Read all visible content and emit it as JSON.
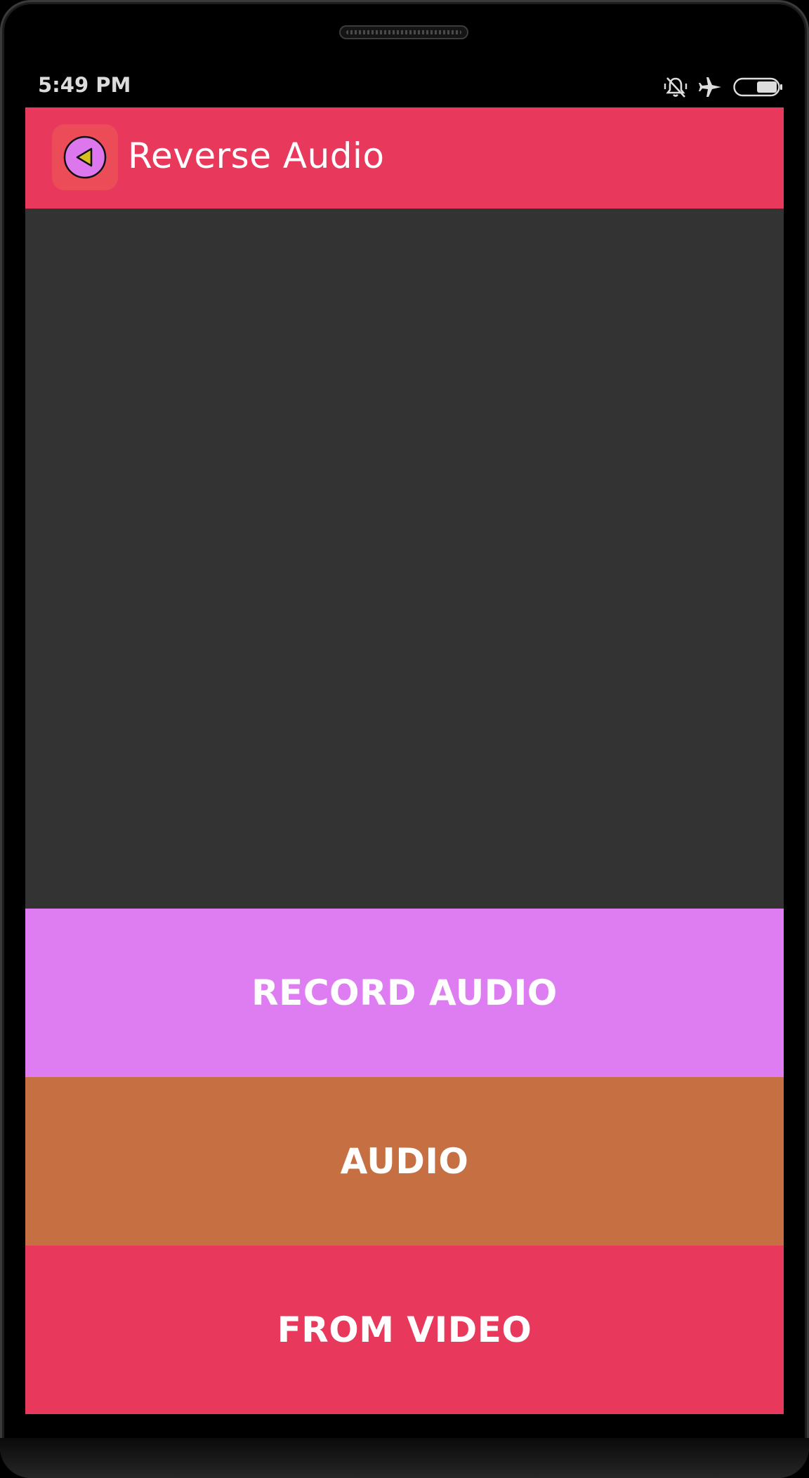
{
  "status_bar": {
    "time": "5:49 PM",
    "icons": [
      "vibrate-bell-off-icon",
      "airplane-icon",
      "battery-icon"
    ]
  },
  "app_bar": {
    "icon": "reverse-play-icon",
    "title": "Reverse Audio"
  },
  "actions": {
    "record_audio": "RECORD AUDIO",
    "audio": "AUDIO",
    "from_video": "FROM VIDEO"
  },
  "colors": {
    "app_bar": "#e8395c",
    "content_background": "#333333",
    "record_audio_button": "#de7df1",
    "audio_button": "#c66f42",
    "from_video_button": "#e8395c",
    "app_icon_circle": "#dd77ee",
    "app_icon_triangle": "#d8c020"
  }
}
